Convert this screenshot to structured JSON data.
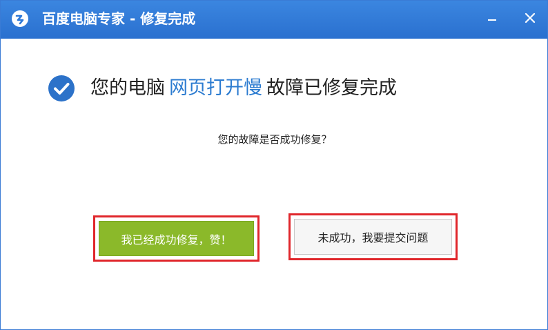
{
  "window": {
    "title": "百度电脑专家 - 修复完成",
    "minimize_symbol": "–",
    "close_symbol": "✕"
  },
  "status": {
    "prefix": "您的电脑",
    "issue_name": "网页打开慢",
    "suffix": "故障已修复完成"
  },
  "question": "您的故障是否成功修复？",
  "buttons": {
    "success_label": "我已经成功修复，赞！",
    "fail_label": "未成功，我要提交问题"
  },
  "icons": {
    "app_logo": "baidu-pc-expert-logo-icon",
    "success": "check-circle-icon"
  },
  "colors": {
    "titlebar": "#2f79d8",
    "accent_link": "#2b7bd0",
    "success_button": "#8bb92a",
    "highlight_frame": "#e0262b"
  }
}
